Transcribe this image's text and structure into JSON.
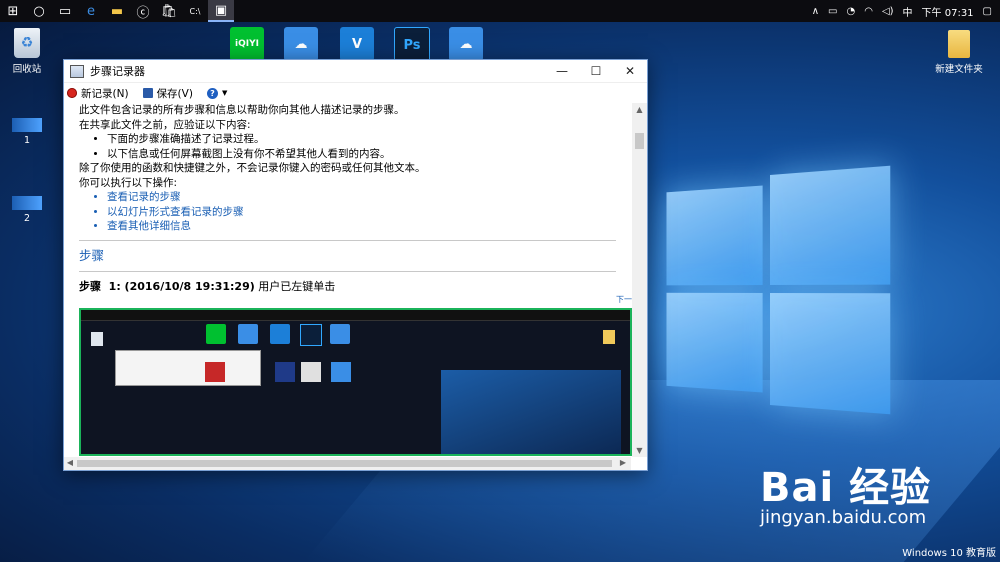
{
  "taskbar": {
    "tray_ime": "中",
    "tray_time": "下午 07:31"
  },
  "desktop": {
    "recycle_bin": "回收站",
    "icon1": "1",
    "icon2": "2",
    "new_folder": "新建文件夹",
    "app_icons": [
      {
        "name": "iqiyi",
        "text": "iQIYI",
        "color": "#00c030"
      },
      {
        "name": "baidu-netdisk",
        "text": "☁",
        "color": "#3a8ee6"
      },
      {
        "name": "vsco",
        "text": "V",
        "color": "#1c7fd8"
      },
      {
        "name": "photoshop",
        "text": "Ps",
        "color": "#0b1f3a"
      },
      {
        "name": "baidu-netdisk-2",
        "text": "☁",
        "color": "#3a8ee6"
      }
    ]
  },
  "window": {
    "title": "步骤记录器",
    "new_record": "新记录(N)",
    "save": "保存(V)",
    "help": "?",
    "lines": {
      "l1": "此文件包含记录的所有步骤和信息以帮助你向其他人描述记录的步骤。",
      "l2": "在共享此文件之前，应验证以下内容:",
      "b1": "下面的步骤准确描述了记录过程。",
      "b2": "以下信息或任何屏幕截图上没有你不希望其他人看到的内容。",
      "l3": "除了你使用的函数和快捷键之外，不会记录你键入的密码或任何其他文本。",
      "l4": "你可以执行以下操作:",
      "link1": "查看记录的步骤",
      "link2": "以幻灯片形式查看记录的步骤",
      "link3": "查看其他详细信息"
    },
    "steps_heading": "步骤",
    "next": "下一个",
    "step_label": "步骤",
    "step1_num_time": "1: (2016/10/8 19:31:29)",
    "step1_desc": "用户已左键单击"
  },
  "watermark": {
    "logo": "Bai 经验",
    "url": "jingyan.baidu.com"
  },
  "edition": "Windows 10 教育版"
}
